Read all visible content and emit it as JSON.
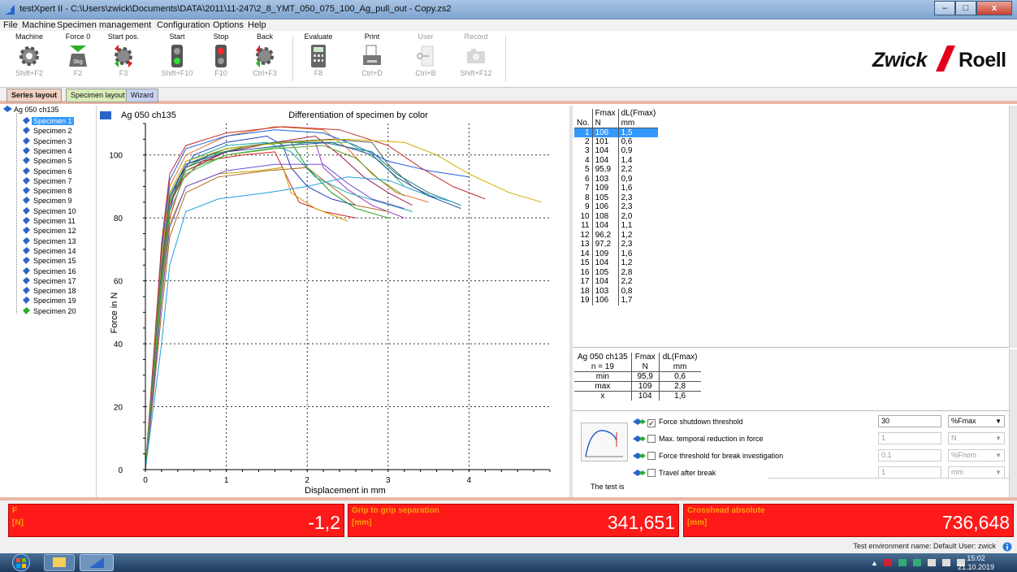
{
  "window": {
    "title": "testXpert II - C:\\Users\\zwick\\Documents\\DATA\\2011\\11-247\\2_8_YMT_050_075_100_Ag_pull_out - Copy.zs2",
    "minimize": "–",
    "maximize": "□",
    "close": "x"
  },
  "menu": [
    "File",
    "Machine",
    "Specimen management",
    "Configuration",
    "Options",
    "Help"
  ],
  "toolbar": [
    {
      "label": "Machine",
      "key": "Shift+F2",
      "icon": "gear-icon",
      "enabled": true
    },
    {
      "label": "Force 0",
      "key": "F2",
      "icon": "weight-icon",
      "enabled": true
    },
    {
      "label": "Start pos.",
      "key": "F3",
      "icon": "gear-arrows-icon",
      "enabled": true
    },
    {
      "label": "Start",
      "key": "Shift+F10",
      "icon": "green-light-icon",
      "enabled": true
    },
    {
      "label": "Stop",
      "key": "F10",
      "icon": "red-light-icon",
      "enabled": true
    },
    {
      "label": "Back",
      "key": "Ctrl+F3",
      "icon": "gear-back-icon",
      "enabled": true
    },
    {
      "label": "Evaluate",
      "key": "F8",
      "icon": "calculator-icon",
      "enabled": true
    },
    {
      "label": "Print",
      "key": "Ctrl+D",
      "icon": "printer-icon",
      "enabled": true
    },
    {
      "label": "User",
      "key": "Ctrl+B",
      "icon": "key-icon",
      "enabled": false
    },
    {
      "label": "Record",
      "key": "Shift+F12",
      "icon": "camera-icon",
      "enabled": false
    }
  ],
  "logo": {
    "word1": "Zwick",
    "word2": "Roell"
  },
  "tabs": [
    "Series layout",
    "Specimen layout",
    "Wizard"
  ],
  "tree": {
    "root": "Ag 050 ch135",
    "items": [
      "Specimen 1",
      "Specimen 2",
      "Specimen 3",
      "Specimen 4",
      "Specimen 5",
      "Specimen 6",
      "Specimen 7",
      "Specimen 8",
      "Specimen 9",
      "Specimen 10",
      "Specimen 11",
      "Specimen 12",
      "Specimen 13",
      "Specimen 14",
      "Specimen 15",
      "Specimen 16",
      "Specimen 17",
      "Specimen 18",
      "Specimen 19",
      "Specimen 20"
    ]
  },
  "graph": {
    "series_label": "Ag 050 ch135"
  },
  "chart_data": {
    "type": "line",
    "title": "Differentiation of specimen by color",
    "xlabel": "Displacement in mm",
    "ylabel": "Force in N",
    "xlim": [
      0,
      5
    ],
    "ylim": [
      0,
      110
    ],
    "xticks": [
      0,
      1,
      2,
      3,
      4
    ],
    "yticks": [
      0,
      20,
      40,
      60,
      80,
      100
    ],
    "grid": true,
    "series": [
      {
        "color": "#1f3fbf",
        "points": [
          [
            0,
            0
          ],
          [
            0.1,
            30
          ],
          [
            0.2,
            60
          ],
          [
            0.3,
            82
          ],
          [
            0.4,
            92
          ],
          [
            0.6,
            100
          ],
          [
            1.0,
            104
          ],
          [
            1.5,
            106
          ],
          [
            1.7,
            103
          ],
          [
            1.8,
            96
          ],
          [
            2.0,
            90
          ],
          [
            2.3,
            86
          ],
          [
            2.6,
            84
          ]
        ]
      },
      {
        "color": "#d62020",
        "points": [
          [
            0,
            0
          ],
          [
            0.1,
            28
          ],
          [
            0.2,
            58
          ],
          [
            0.3,
            80
          ],
          [
            0.45,
            92
          ],
          [
            0.7,
            98
          ],
          [
            1.2,
            100
          ],
          [
            1.6,
            101
          ],
          [
            1.75,
            93
          ],
          [
            1.9,
            85
          ],
          [
            2.2,
            82
          ],
          [
            2.6,
            80
          ]
        ]
      },
      {
        "color": "#18a018",
        "points": [
          [
            0,
            0
          ],
          [
            0.1,
            30
          ],
          [
            0.2,
            62
          ],
          [
            0.3,
            84
          ],
          [
            0.5,
            96
          ],
          [
            0.8,
            100
          ],
          [
            1.3,
            103
          ],
          [
            1.8,
            104
          ],
          [
            2.0,
            96
          ],
          [
            2.3,
            88
          ],
          [
            2.6,
            83
          ],
          [
            3.0,
            80
          ]
        ]
      },
      {
        "color": "#9a3fbf",
        "points": [
          [
            0,
            0
          ],
          [
            0.1,
            32
          ],
          [
            0.2,
            64
          ],
          [
            0.3,
            86
          ],
          [
            0.5,
            97
          ],
          [
            1.0,
            102
          ],
          [
            1.6,
            104
          ],
          [
            2.1,
            104
          ],
          [
            2.2,
            96
          ],
          [
            2.5,
            89
          ],
          [
            2.8,
            84
          ],
          [
            3.2,
            80
          ]
        ]
      },
      {
        "color": "#c8a000",
        "points": [
          [
            0,
            0
          ],
          [
            0.1,
            26
          ],
          [
            0.2,
            55
          ],
          [
            0.3,
            78
          ],
          [
            0.5,
            90
          ],
          [
            0.9,
            94
          ],
          [
            1.4,
            95
          ],
          [
            1.7,
            96
          ],
          [
            1.8,
            88
          ],
          [
            2.1,
            83
          ],
          [
            2.5,
            79
          ]
        ]
      },
      {
        "color": "#18a8a8",
        "points": [
          [
            0,
            0
          ],
          [
            0.1,
            33
          ],
          [
            0.2,
            66
          ],
          [
            0.3,
            88
          ],
          [
            0.5,
            98
          ],
          [
            1.0,
            103
          ],
          [
            1.5,
            104
          ],
          [
            1.8,
            101
          ],
          [
            2.1,
            93
          ],
          [
            2.5,
            88
          ],
          [
            2.9,
            85
          ],
          [
            3.3,
            82
          ]
        ]
      },
      {
        "color": "#e07020",
        "points": [
          [
            0,
            0
          ],
          [
            0.1,
            34
          ],
          [
            0.2,
            68
          ],
          [
            0.3,
            90
          ],
          [
            0.5,
            100
          ],
          [
            1.0,
            106
          ],
          [
            1.6,
            109
          ],
          [
            2.2,
            108
          ],
          [
            2.5,
            102
          ],
          [
            2.8,
            94
          ],
          [
            3.1,
            88
          ],
          [
            3.5,
            85
          ]
        ]
      },
      {
        "color": "#5a5a5a",
        "points": [
          [
            0,
            0
          ],
          [
            0.1,
            31
          ],
          [
            0.2,
            62
          ],
          [
            0.3,
            85
          ],
          [
            0.5,
            96
          ],
          [
            1.0,
            101
          ],
          [
            1.6,
            104
          ],
          [
            2.3,
            105
          ],
          [
            2.8,
            104
          ],
          [
            3.0,
            97
          ],
          [
            3.3,
            90
          ],
          [
            3.6,
            86
          ]
        ]
      },
      {
        "color": "#a02050",
        "points": [
          [
            0,
            0
          ],
          [
            0.1,
            30
          ],
          [
            0.2,
            61
          ],
          [
            0.3,
            84
          ],
          [
            0.5,
            95
          ],
          [
            1.0,
            101
          ],
          [
            1.6,
            104
          ],
          [
            2.1,
            106
          ],
          [
            2.4,
            100
          ],
          [
            2.7,
            93
          ],
          [
            3.0,
            88
          ],
          [
            3.3,
            84
          ]
        ]
      },
      {
        "color": "#2060e0",
        "points": [
          [
            0,
            0
          ],
          [
            0.1,
            35
          ],
          [
            0.2,
            70
          ],
          [
            0.3,
            92
          ],
          [
            0.5,
            102
          ],
          [
            1.0,
            106
          ],
          [
            1.6,
            108
          ],
          [
            2.2,
            107
          ],
          [
            2.6,
            103
          ],
          [
            3.0,
            98
          ],
          [
            3.5,
            95
          ],
          [
            4.0,
            93
          ]
        ]
      },
      {
        "color": "#30c060",
        "points": [
          [
            0,
            0
          ],
          [
            0.1,
            29
          ],
          [
            0.2,
            58
          ],
          [
            0.3,
            82
          ],
          [
            0.5,
            94
          ],
          [
            1.0,
            100
          ],
          [
            1.5,
            102
          ],
          [
            2.0,
            104
          ],
          [
            2.5,
            104
          ],
          [
            2.9,
            98
          ],
          [
            3.2,
            90
          ],
          [
            3.6,
            86
          ]
        ]
      },
      {
        "color": "#b06820",
        "points": [
          [
            0,
            0
          ],
          [
            0.1,
            24
          ],
          [
            0.2,
            50
          ],
          [
            0.3,
            74
          ],
          [
            0.5,
            88
          ],
          [
            0.9,
            93
          ],
          [
            1.5,
            95
          ],
          [
            2.0,
            96
          ],
          [
            2.3,
            90
          ],
          [
            2.6,
            84
          ],
          [
            3.0,
            82
          ]
        ]
      },
      {
        "color": "#7050d0",
        "points": [
          [
            0,
            0
          ],
          [
            0.1,
            26
          ],
          [
            0.2,
            54
          ],
          [
            0.3,
            77
          ],
          [
            0.5,
            90
          ],
          [
            1.0,
            95
          ],
          [
            1.6,
            97
          ],
          [
            2.2,
            97
          ],
          [
            2.5,
            91
          ],
          [
            2.8,
            86
          ],
          [
            3.2,
            83
          ]
        ]
      },
      {
        "color": "#c03030",
        "points": [
          [
            0,
            0
          ],
          [
            0.1,
            36
          ],
          [
            0.2,
            72
          ],
          [
            0.3,
            94
          ],
          [
            0.5,
            103
          ],
          [
            1.0,
            107
          ],
          [
            1.7,
            109
          ],
          [
            2.4,
            108
          ],
          [
            3.0,
            103
          ],
          [
            3.4,
            96
          ],
          [
            3.8,
            90
          ],
          [
            4.2,
            86
          ]
        ]
      },
      {
        "color": "#108080",
        "points": [
          [
            0,
            0
          ],
          [
            0.1,
            31
          ],
          [
            0.2,
            63
          ],
          [
            0.3,
            86
          ],
          [
            0.5,
            97
          ],
          [
            1.0,
            102
          ],
          [
            1.6,
            104
          ],
          [
            2.2,
            104
          ],
          [
            2.8,
            101
          ],
          [
            3.1,
            94
          ],
          [
            3.5,
            88
          ],
          [
            3.9,
            84
          ]
        ]
      },
      {
        "color": "#d0b000",
        "points": [
          [
            0,
            0
          ],
          [
            0.1,
            33
          ],
          [
            0.2,
            66
          ],
          [
            0.3,
            88
          ],
          [
            0.5,
            98
          ],
          [
            1.0,
            102
          ],
          [
            1.7,
            104
          ],
          [
            2.5,
            105
          ],
          [
            3.2,
            104
          ],
          [
            3.6,
            100
          ],
          [
            4.0,
            94
          ],
          [
            4.5,
            88
          ],
          [
            4.9,
            85
          ]
        ]
      },
      {
        "color": "#3050a0",
        "points": [
          [
            0,
            0
          ],
          [
            0.1,
            32
          ],
          [
            0.2,
            64
          ],
          [
            0.3,
            87
          ],
          [
            0.5,
            97
          ],
          [
            1.0,
            101
          ],
          [
            1.7,
            103
          ],
          [
            2.3,
            104
          ],
          [
            2.8,
            100
          ],
          [
            3.1,
            93
          ],
          [
            3.5,
            87
          ],
          [
            3.9,
            83
          ]
        ]
      },
      {
        "color": "#60a020",
        "points": [
          [
            0,
            0
          ],
          [
            0.1,
            30
          ],
          [
            0.2,
            62
          ],
          [
            0.3,
            85
          ],
          [
            0.5,
            95
          ],
          [
            1.0,
            100
          ],
          [
            1.6,
            102
          ],
          [
            2.2,
            103
          ],
          [
            2.6,
            99
          ],
          [
            2.9,
            92
          ],
          [
            3.2,
            87
          ]
        ]
      },
      {
        "color": "#20a0e0",
        "points": [
          [
            0,
            0
          ],
          [
            0.1,
            20
          ],
          [
            0.2,
            40
          ],
          [
            0.3,
            65
          ],
          [
            0.5,
            82
          ],
          [
            0.9,
            86
          ],
          [
            1.5,
            88
          ],
          [
            2.0,
            90
          ],
          [
            2.5,
            93
          ],
          [
            3.0,
            92
          ],
          [
            3.4,
            88
          ],
          [
            3.8,
            85
          ]
        ]
      }
    ]
  },
  "results": {
    "header_top": [
      "",
      "Fmax",
      "dL(Fmax)"
    ],
    "header_unit": [
      "No.",
      "N",
      "mm"
    ],
    "rows": [
      [
        "1",
        "106",
        "1,5"
      ],
      [
        "2",
        "101",
        "0,6"
      ],
      [
        "3",
        "104",
        "0,9"
      ],
      [
        "4",
        "104",
        "1,4"
      ],
      [
        "5",
        "95,9",
        "2,2"
      ],
      [
        "6",
        "103",
        "0,9"
      ],
      [
        "7",
        "109",
        "1,6"
      ],
      [
        "8",
        "105",
        "2,3"
      ],
      [
        "9",
        "106",
        "2,3"
      ],
      [
        "10",
        "108",
        "2,0"
      ],
      [
        "11",
        "104",
        "1,1"
      ],
      [
        "12",
        "96,2",
        "1,2"
      ],
      [
        "13",
        "97,2",
        "2,3"
      ],
      [
        "14",
        "109",
        "1,6"
      ],
      [
        "15",
        "104",
        "1,2"
      ],
      [
        "16",
        "105",
        "2,8"
      ],
      [
        "17",
        "104",
        "2,2"
      ],
      [
        "18",
        "103",
        "0,8"
      ],
      [
        "19",
        "106",
        "1,7"
      ]
    ]
  },
  "statistics": {
    "header": [
      "Ag 050 ch135",
      "Fmax",
      "dL(Fmax)"
    ],
    "units": [
      "n = 19",
      "N",
      "mm"
    ],
    "rows": [
      [
        "min",
        "95,9",
        "0,6"
      ],
      [
        "max",
        "109",
        "2,8"
      ],
      [
        "x",
        "104",
        "1,6"
      ]
    ]
  },
  "settings": {
    "caption": "The test is",
    "rows": [
      {
        "label": "Force shutdown threshold",
        "checked": true,
        "value": "30",
        "unit": "%Fmax",
        "enabled": true
      },
      {
        "label": "Max. temporal reduction in force",
        "checked": false,
        "value": "1",
        "unit": "N",
        "enabled": false
      },
      {
        "label": "Force threshold for break investigation",
        "checked": false,
        "value": "0,1",
        "unit": "%Fnom",
        "enabled": false
      },
      {
        "label": "Travel after break",
        "checked": false,
        "value": "1",
        "unit": "mm",
        "enabled": false
      }
    ]
  },
  "displays": [
    {
      "name": "F",
      "unit": "[N]",
      "value": "-1,2"
    },
    {
      "name": "Grip to grip separation",
      "unit": "[mm]",
      "value": "341,651"
    },
    {
      "name": "Crosshead absolute",
      "unit": "[mm]",
      "value": "736,648"
    }
  ],
  "env": {
    "text": "Test environment name: Default   User: zwick"
  },
  "clock": {
    "time": "15:02",
    "date": "21.10.2019"
  },
  "colors": {
    "display_bg": "#ff1a1a",
    "display_label": "#f6a000",
    "selection": "#3399ff",
    "accent": "#e9b7a6"
  }
}
